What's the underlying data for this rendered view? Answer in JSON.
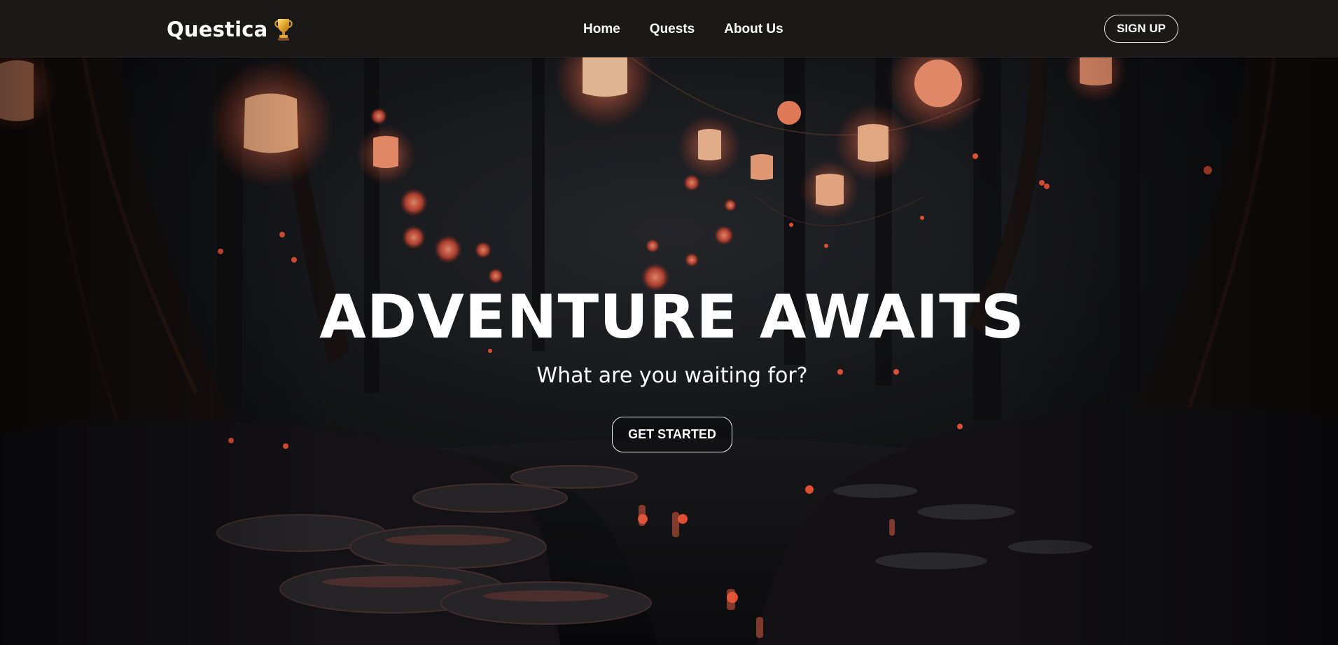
{
  "nav": {
    "brand": "Questica",
    "brand_icon": "trophy-icon",
    "links": [
      {
        "label": "Home"
      },
      {
        "label": "Quests"
      },
      {
        "label": "About Us"
      }
    ],
    "signup_label": "SIGN UP"
  },
  "hero": {
    "title": "ADVENTURE AWAITS",
    "subtitle": "What are you waiting for?",
    "cta_label": "GET STARTED",
    "background": "forest-lantern-illustration"
  },
  "colors": {
    "navbar_bg": "#1a1918",
    "text": "#ffffff",
    "lantern_glow": "#ff6a4a",
    "forest_dark": "#0c0b0d"
  }
}
